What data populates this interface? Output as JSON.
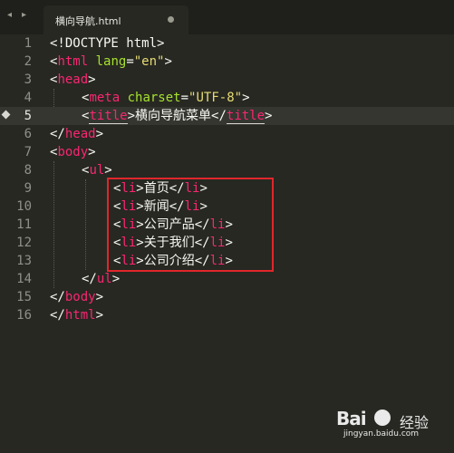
{
  "tabbar": {
    "nav_left": "◂",
    "nav_right": "▸",
    "tab_title": "横向导航.html"
  },
  "editor": {
    "line_numbers": [
      "1",
      "2",
      "3",
      "4",
      "5",
      "6",
      "7",
      "8",
      "9",
      "10",
      "11",
      "12",
      "13",
      "14",
      "15",
      "16"
    ],
    "current_line": 5,
    "code": {
      "l1": "<!DOCTYPE html>",
      "l2_open": "<",
      "l2_tag": "html",
      "l2_attr": "lang",
      "l2_eq": "=",
      "l2_val": "\"en\"",
      "l2_close": ">",
      "l3_open": "<",
      "l3_tag": "head",
      "l3_close": ">",
      "l4_open": "<",
      "l4_tag": "meta",
      "l4_attr": "charset",
      "l4_eq": "=",
      "l4_val": "\"UTF-8\"",
      "l4_close": ">",
      "l5_open": "<",
      "l5_tag": "title",
      "l5_mid1": ">",
      "l5_text": "横向导航菜单",
      "l5_mid2": "</",
      "l5_tag2": "title",
      "l5_close": ">",
      "l6_open": "</",
      "l6_tag": "head",
      "l6_close": ">",
      "l7_open": "<",
      "l7_tag": "body",
      "l7_close": ">",
      "l8_open": "<",
      "l8_tag": "ul",
      "l8_close": ">",
      "li_tag": "li",
      "li_items": [
        "首页",
        "新闻",
        "公司产品",
        "关于我们",
        "公司介绍"
      ],
      "l14_open": "</",
      "l14_tag": "ul",
      "l14_close": ">",
      "l15_open": "</",
      "l15_tag": "body",
      "l15_close": ">",
      "l16_open": "</",
      "l16_tag": "html",
      "l16_close": ">"
    }
  },
  "colors": {
    "background": "#272822",
    "tag": "#f92672",
    "attribute": "#a6e22e",
    "string": "#e6db74",
    "highlight_box": "#e0262b"
  },
  "watermark": {
    "logo": "Bai",
    "logo_cn": "经验",
    "url": "jingyan.baidu.com"
  }
}
